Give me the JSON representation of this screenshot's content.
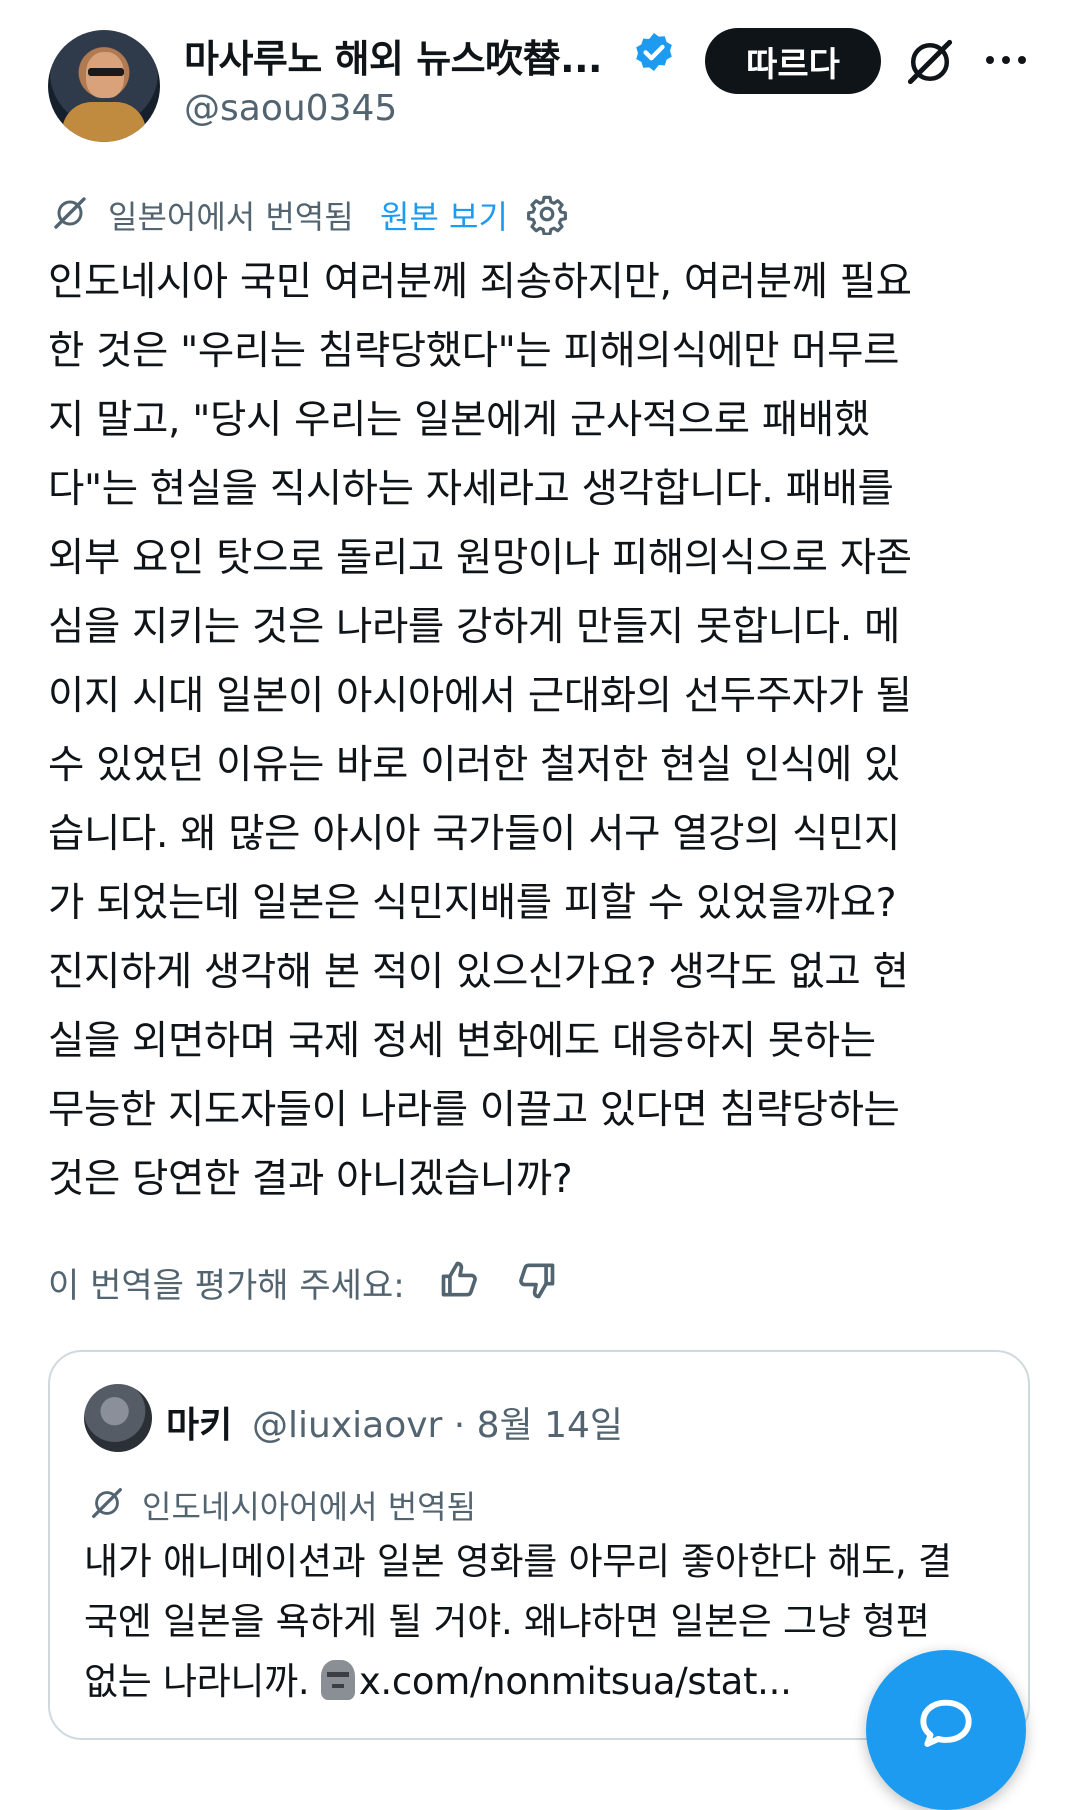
{
  "author": {
    "display_name": "마사루노 해외 뉴스吹替...",
    "handle": "@saou0345"
  },
  "header": {
    "follow_label": "따르다"
  },
  "translation": {
    "label": "일본어에서 번역됨",
    "view_original": "원본 보기"
  },
  "post": {
    "lines": [
      "인도네시아 국민 여러분께 죄송하지만, 여러분께 필요",
      "한 것은 \"우리는 침략당했다\"는 피해의식에만 머무르",
      "지 말고, \"당시 우리는 일본에게 군사적으로 패배했",
      "다\"는 현실을 직시하는 자세라고 생각합니다. 패배를",
      "외부 요인 탓으로 돌리고 원망이나 피해의식으로 자존",
      "심을 지키는 것은 나라를 강하게 만들지 못합니다. 메",
      "이지 시대 일본이 아시아에서 근대화의 선두주자가 될",
      "수 있었던 이유는 바로 이러한 철저한 현실 인식에 있",
      "습니다. 왜 많은 아시아 국가들이 서구 열강의 식민지",
      "가 되었는데 일본은 식민지배를 피할 수 있었을까요?",
      "진지하게 생각해 본 적이 있으신가요? 생각도 없고 현",
      "실을 외면하며 국제 정세 변화에도 대응하지 못하는",
      "무능한 지도자들이 나라를 이끌고 있다면 침략당하는",
      "것은 당연한 결과 아니겠습니까?"
    ]
  },
  "rating": {
    "label": "이 번역을 평가해 주세요:"
  },
  "quote": {
    "name": "마키",
    "handle_date": "@liuxiaovr · 8월 14일",
    "translation_label": "인도네시아어에서 번역됨",
    "lines": [
      "내가 애니메이션과 일본 영화를 아무리 좋아한다 해도, 결",
      "국엔 일본을 욕하게 될 거야. 왜냐하면 일본은 그냥 형편"
    ],
    "last_line_text": "없는 나라니까. ",
    "link": "x.com/nonmitsua/stat..."
  },
  "colors": {
    "accent": "#1d9bf0",
    "secondary_text": "#536471",
    "border": "#cfd9de"
  },
  "icons": [
    "verified-badge-icon",
    "grok-icon",
    "more-icon",
    "translate-icon",
    "gear-icon",
    "thumbs-up-icon",
    "thumbs-down-icon",
    "moai-emoji-icon",
    "compose-reply-icon"
  ]
}
